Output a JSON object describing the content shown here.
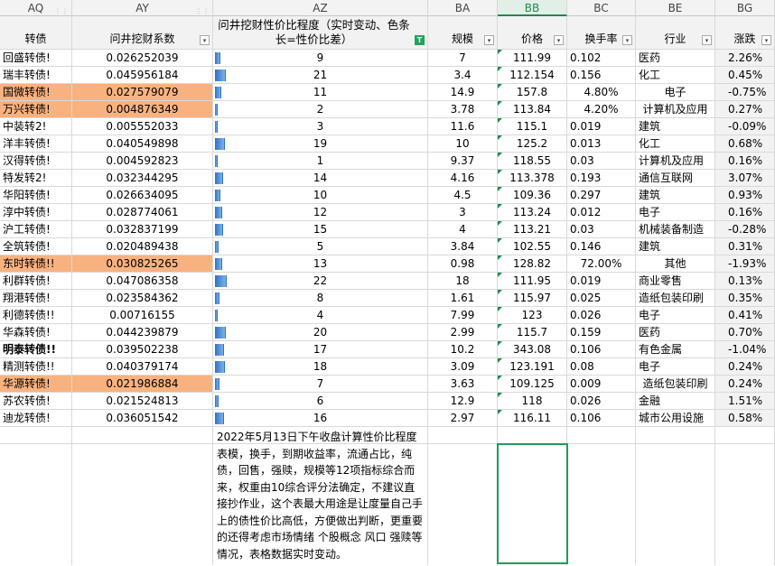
{
  "columns": [
    "AQ",
    "AY",
    "AZ",
    "BA",
    "BB",
    "BC",
    "BE",
    "BG"
  ],
  "selected_column": "BB",
  "headers": {
    "name": "转债",
    "coef": "问井挖财系数",
    "rank": "问井挖财性价比程度（实时变动、色条长=性价比差）",
    "scale": "规模",
    "price": "价格",
    "turnover": "换手率",
    "industry": "行业",
    "change": "涨跌"
  },
  "filter_icon": "▾",
  "filter_active_icon": "T",
  "rows": [
    {
      "name": "回盛转债!",
      "coef": "0.026252039",
      "rank": "9",
      "scale": "7",
      "price": "111.99",
      "turnover": "0.102",
      "industry": "医药",
      "change": "2.26%",
      "hl": false,
      "bold": false
    },
    {
      "name": "瑞丰转债!",
      "coef": "0.045956184",
      "rank": "21",
      "scale": "3.4",
      "price": "112.154",
      "turnover": "0.156",
      "industry": "化工",
      "change": "0.45%",
      "hl": false,
      "bold": false
    },
    {
      "name": "国微转债!",
      "coef": "0.027579079",
      "rank": "11",
      "scale": "14.9",
      "price": "157.8",
      "turnover": "4.80%",
      "industry": "电子",
      "change": "-0.75%",
      "hl": true,
      "bold": false
    },
    {
      "name": "万兴转债!",
      "coef": "0.004876349",
      "rank": "2",
      "scale": "3.78",
      "price": "113.84",
      "turnover": "4.20%",
      "industry": "计算机及应用",
      "change": "0.27%",
      "hl": true,
      "bold": false
    },
    {
      "name": "中装转2!",
      "coef": "0.005552033",
      "rank": "3",
      "scale": "11.6",
      "price": "115.1",
      "turnover": "0.019",
      "industry": "建筑",
      "change": "-0.09%",
      "hl": false,
      "bold": false
    },
    {
      "name": "洋丰转债!",
      "coef": "0.040549898",
      "rank": "19",
      "scale": "10",
      "price": "125.2",
      "turnover": "0.013",
      "industry": "化工",
      "change": "0.68%",
      "hl": false,
      "bold": false
    },
    {
      "name": "汉得转债!",
      "coef": "0.004592823",
      "rank": "1",
      "scale": "9.37",
      "price": "118.55",
      "turnover": "0.03",
      "industry": "计算机及应用",
      "change": "0.16%",
      "hl": false,
      "bold": false
    },
    {
      "name": "特发转2!",
      "coef": "0.032344295",
      "rank": "14",
      "scale": "4.16",
      "price": "113.378",
      "turnover": "0.193",
      "industry": "通信互联网",
      "change": "3.07%",
      "hl": false,
      "bold": false
    },
    {
      "name": "华阳转债!",
      "coef": "0.026634095",
      "rank": "10",
      "scale": "4.5",
      "price": "109.36",
      "turnover": "0.297",
      "industry": "建筑",
      "change": "0.93%",
      "hl": false,
      "bold": false
    },
    {
      "name": "淳中转债!",
      "coef": "0.028774061",
      "rank": "12",
      "scale": "3",
      "price": "113.24",
      "turnover": "0.012",
      "industry": "电子",
      "change": "0.16%",
      "hl": false,
      "bold": false
    },
    {
      "name": "沪工转债!",
      "coef": "0.032837199",
      "rank": "15",
      "scale": "4",
      "price": "113.21",
      "turnover": "0.03",
      "industry": "机械装备制造",
      "change": "-0.28%",
      "hl": false,
      "bold": false
    },
    {
      "name": "全筑转债!",
      "coef": "0.020489438",
      "rank": "5",
      "scale": "3.84",
      "price": "102.55",
      "turnover": "0.146",
      "industry": "建筑",
      "change": "0.31%",
      "hl": false,
      "bold": false
    },
    {
      "name": "东时转债!!",
      "coef": "0.030825265",
      "rank": "13",
      "scale": "0.98",
      "price": "128.82",
      "turnover": "72.00%",
      "industry": "其他",
      "change": "-1.93%",
      "hl": true,
      "bold": false
    },
    {
      "name": "利群转债!",
      "coef": "0.047086358",
      "rank": "22",
      "scale": "18",
      "price": "111.95",
      "turnover": "0.019",
      "industry": "商业零售",
      "change": "0.13%",
      "hl": false,
      "bold": false
    },
    {
      "name": "翔港转债!",
      "coef": "0.023584362",
      "rank": "8",
      "scale": "1.61",
      "price": "115.97",
      "turnover": "0.025",
      "industry": "造纸包装印刷",
      "change": "0.35%",
      "hl": false,
      "bold": false
    },
    {
      "name": "利德转债!!",
      "coef": "0.00716155",
      "rank": "4",
      "scale": "7.99",
      "price": "123",
      "turnover": "0.026",
      "industry": "电子",
      "change": "0.41%",
      "hl": false,
      "bold": false
    },
    {
      "name": "华森转债!",
      "coef": "0.044239879",
      "rank": "20",
      "scale": "2.99",
      "price": "115.7",
      "turnover": "0.159",
      "industry": "医药",
      "change": "0.70%",
      "hl": false,
      "bold": false
    },
    {
      "name": "明泰转债!!",
      "coef": "0.039502238",
      "rank": "17",
      "scale": "10.2",
      "price": "343.08",
      "turnover": "0.106",
      "industry": "有色金属",
      "change": "-1.04%",
      "hl": false,
      "bold": true
    },
    {
      "name": "精测转债!!",
      "coef": "0.040379174",
      "rank": "18",
      "scale": "3.09",
      "price": "123.191",
      "turnover": "0.08",
      "industry": "电子",
      "change": "0.24%",
      "hl": false,
      "bold": false
    },
    {
      "name": "华源转债!",
      "coef": "0.021986884",
      "rank": "7",
      "scale": "3.63",
      "price": "109.125",
      "turnover": "0.009",
      "industry": "造纸包装印刷",
      "change": "0.24%",
      "hl": true,
      "bold": false
    },
    {
      "name": "苏农转债!",
      "coef": "0.021524813",
      "rank": "6",
      "scale": "12.9",
      "price": "118",
      "turnover": "0.026",
      "industry": "金融",
      "change": "1.51%",
      "hl": false,
      "bold": false
    },
    {
      "name": "迪龙转债!",
      "coef": "0.036051542",
      "rank": "16",
      "scale": "2.97",
      "price": "116.11",
      "turnover": "0.106",
      "industry": "城市公用设施",
      "change": "0.58%",
      "hl": false,
      "bold": false
    }
  ],
  "note": "2022年5月13日下午收盘计算性价比程度表模，换手，到期收益率，流通占比，纯债，回售，强赎，规模等12项指标综合而来，权重由10综合评分法确定，不建议直接抄作业，这个表最大用途是让度量自己手上的债性价比高低，方便做出判断，更重要的还得考虑市场情绪 个股概念 风口 强赎等情况，表格数据实时变动。"
}
